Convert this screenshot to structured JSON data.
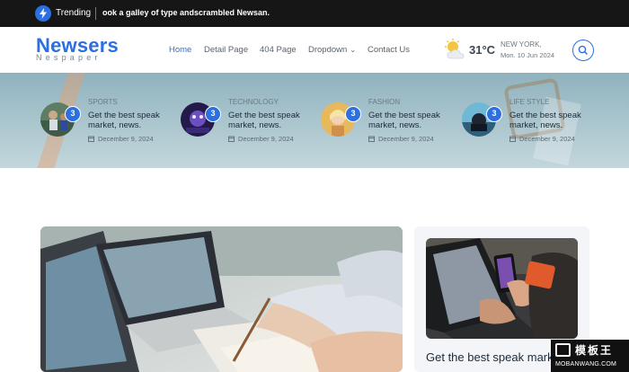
{
  "topbar": {
    "trending_label": "Trending",
    "trending_text": "ook a galley of type andscrambled Newsan."
  },
  "header": {
    "logo": "Newsers",
    "logo_sub": "Nespaper",
    "nav": [
      "Home",
      "Detail Page",
      "404 Page",
      "Dropdown",
      "Contact Us"
    ],
    "active_nav": "Home",
    "weather": {
      "temp": "31°C",
      "city": "NEW YORK,",
      "date": "Mon. 10 Jun 2024",
      "icon": "partly-cloudy-icon"
    },
    "search_icon": "search-icon"
  },
  "featured": [
    {
      "category": "SPORTS",
      "title": "Get the best speak market, news.",
      "date": "December 9, 2024",
      "count": "3"
    },
    {
      "category": "TECHNOLOGY",
      "title": "Get the best speak market, news.",
      "date": "December 9, 2024",
      "count": "3"
    },
    {
      "category": "FASHION",
      "title": "Get the best speak market, news.",
      "date": "December 9, 2024",
      "count": "3"
    },
    {
      "category": "LIFE STYLE",
      "title": "Get the best speak market, news.",
      "date": "December 9, 2024",
      "count": "3"
    }
  ],
  "side_article": {
    "title": "Get the best speak market, news."
  },
  "watermark": {
    "cn": "模板王",
    "en": "MOBANWANG.COM"
  },
  "colors": {
    "accent": "#2b6fe0",
    "topbar": "#161616",
    "strip": "#a7c3cc"
  }
}
